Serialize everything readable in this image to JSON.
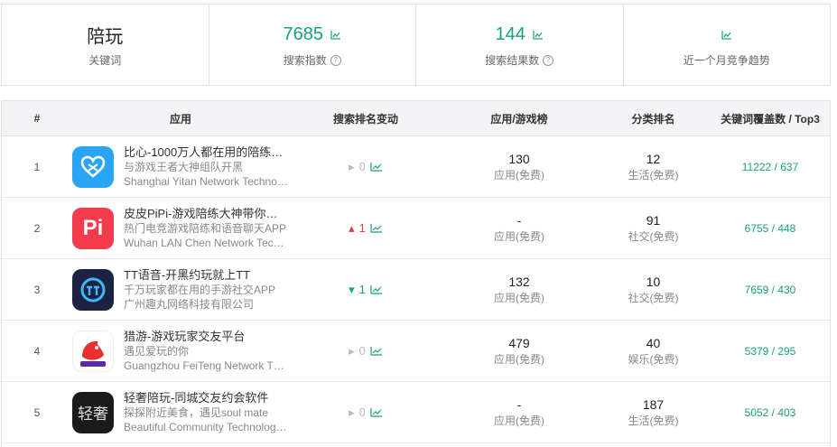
{
  "summary": {
    "keyword": "陪玩",
    "keyword_label": "关键词",
    "search_index": "7685",
    "search_index_label": "搜索指数",
    "result_count": "144",
    "result_count_label": "搜索结果数",
    "trend_label": "近一个月竞争趋势"
  },
  "table": {
    "headers": {
      "num": "#",
      "app": "应用",
      "rank_change": "搜索排名变动",
      "chart": "应用/游戏榜",
      "category": "分类排名",
      "coverage": "关键词覆盖数 / Top3"
    },
    "rows": [
      {
        "num": "1",
        "name": "比心-1000万人都在用的陪练…",
        "subtitle": "与游戏王者大神组队开黑",
        "developer": "Shanghai Yitan Network Techno…",
        "rank_change": "0",
        "chart_rank": "130",
        "chart_type": "应用(免费)",
        "category_rank": "12",
        "category": "生活(免费)",
        "coverage": "11222 / 637",
        "icon_color": "#2aa5f5",
        "icon": "heart-icon"
      },
      {
        "num": "2",
        "name": "皮皮PiPi-游戏陪练大神带你…",
        "subtitle": "热门电竞游戏陪练和语音聊天APP",
        "developer": "Wuhan LAN Chen Network Tec…",
        "rank_change": "1",
        "chart_rank": "-",
        "chart_type": "应用(免费)",
        "category_rank": "91",
        "category": "社交(免费)",
        "coverage": "6755 / 448",
        "icon_color": "#f23c4c",
        "icon": "pi-logo-icon"
      },
      {
        "num": "3",
        "name": "TT语音-开黑约玩就上TT",
        "subtitle": "千万玩家都在用的手游社交APP",
        "developer": "广州趣丸网络科技有限公司",
        "rank_change": "1",
        "chart_rank": "132",
        "chart_type": "应用(免费)",
        "category_rank": "10",
        "category": "社交(免费)",
        "coverage": "7659 / 430",
        "icon_color": "#1c2340",
        "icon": "tt-logo-icon"
      },
      {
        "num": "4",
        "name": "猎游-游戏玩家交友平台",
        "subtitle": "遇见爱玩的你",
        "developer": "Guangzhou FeiTeng Network T…",
        "rank_change": "0",
        "chart_rank": "479",
        "chart_type": "应用(免费)",
        "category_rank": "40",
        "category": "娱乐(免费)",
        "coverage": "5379 / 295",
        "icon_color": "#ffffff",
        "icon": "fox-logo-icon"
      },
      {
        "num": "5",
        "name": "轻奢陪玩-同城交友约会软件",
        "subtitle": "探探附近美食，遇见soul mate",
        "developer": "Beautiful Community Technolog…",
        "rank_change": "0",
        "chart_rank": "-",
        "chart_type": "应用(免费)",
        "category_rank": "187",
        "category": "生活(免费)",
        "coverage": "5052 / 403",
        "icon_color": "#1a1a1a",
        "icon": "qingshe-logo-icon",
        "icon_text": "轻奢"
      }
    ]
  },
  "colors": {
    "accent": "#1aa07a",
    "up": "#e04040",
    "flat": "#bbbbbb"
  }
}
